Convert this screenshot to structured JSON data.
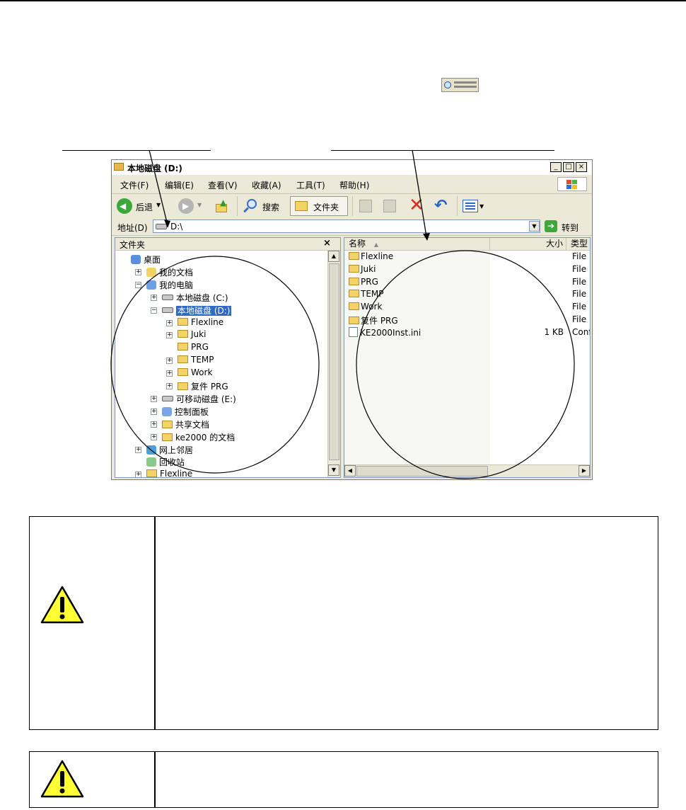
{
  "window": {
    "title": "本地磁盘 (D:)",
    "caption_buttons": {
      "minimize": "_",
      "maximize": "□",
      "close": "×"
    }
  },
  "menu": [
    "文件(F)",
    "编辑(E)",
    "查看(V)",
    "收藏(A)",
    "工具(T)",
    "帮助(H)"
  ],
  "toolbar": {
    "back": "后退",
    "search": "搜索",
    "folders": "文件夹"
  },
  "address": {
    "label": "地址(D)",
    "value": "D:\\",
    "go": "转到"
  },
  "folder_pane": {
    "title": "文件夹",
    "close": "×",
    "items": [
      {
        "label": "桌面",
        "icon": "desktop-icon"
      },
      {
        "label": "我的文档",
        "icon": "documents-icon",
        "expander": "+"
      },
      {
        "label": "我的电脑",
        "icon": "computer-icon",
        "expander": "−"
      },
      {
        "label": "本地磁盘 (C:)",
        "icon": "drive-icon",
        "expander": "+"
      },
      {
        "label": "本地磁盘 (D:)",
        "icon": "drive-icon",
        "expander": "−",
        "selected": true
      },
      {
        "label": "Flexline",
        "icon": "folder-icon",
        "expander": "+"
      },
      {
        "label": "Juki",
        "icon": "folder-icon",
        "expander": "+"
      },
      {
        "label": "PRG",
        "icon": "folder-icon"
      },
      {
        "label": "TEMP",
        "icon": "folder-icon",
        "expander": "+"
      },
      {
        "label": "Work",
        "icon": "folder-icon",
        "expander": "+"
      },
      {
        "label": "复件 PRG",
        "icon": "folder-icon",
        "expander": "+"
      },
      {
        "label": "可移动磁盘 (E:)",
        "icon": "drive-icon",
        "expander": "+"
      },
      {
        "label": "控制面板",
        "icon": "control-panel-icon",
        "expander": "+"
      },
      {
        "label": "共享文档",
        "icon": "folder-icon",
        "expander": "+"
      },
      {
        "label": "ke2000 的文档",
        "icon": "folder-icon",
        "expander": "+"
      },
      {
        "label": "网上邻居",
        "icon": "network-icon",
        "expander": "+"
      },
      {
        "label": "回收站",
        "icon": "recycle-bin-icon"
      },
      {
        "label": "Flexline",
        "icon": "folder-icon",
        "expander": "+"
      }
    ]
  },
  "file_list": {
    "columns": {
      "name": "名称",
      "size": "大小",
      "type": "类型"
    },
    "rows": [
      {
        "name": "Flexline",
        "size": "",
        "type": "File F"
      },
      {
        "name": "Juki",
        "size": "",
        "type": "File F"
      },
      {
        "name": "PRG",
        "size": "",
        "type": "File F"
      },
      {
        "name": "TEMP",
        "size": "",
        "type": "File F"
      },
      {
        "name": "Work",
        "size": "",
        "type": "File F"
      },
      {
        "name": "复件 PRG",
        "size": "",
        "type": "File F"
      },
      {
        "name": "KE2000Inst.ini",
        "size": "1 KB",
        "type": "Conf"
      }
    ]
  }
}
